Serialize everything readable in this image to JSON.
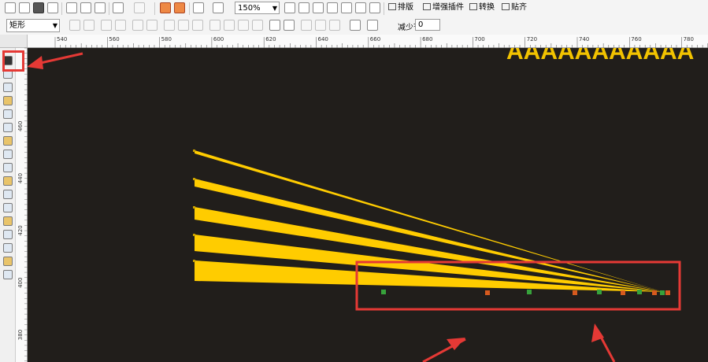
{
  "toolbar": {
    "zoom_value": "150%",
    "menu_items": [
      {
        "label": "排版"
      },
      {
        "label": "增强插件"
      },
      {
        "label": "转换"
      },
      {
        "label": "贴齐"
      }
    ]
  },
  "property_bar": {
    "shape_selector": "矩形",
    "reduce_nodes_label": "减少节点",
    "reduce_nodes_value": "0"
  },
  "rulers": {
    "horizontal_labels": [
      "540",
      "560",
      "580",
      "600",
      "620",
      "640",
      "660",
      "680",
      "700",
      "720",
      "740",
      "760",
      "780"
    ],
    "vertical_labels": [
      "460",
      "440",
      "420",
      "400",
      "380"
    ]
  },
  "canvas": {
    "background": "#211e1b",
    "shape_color": "#ffcc00",
    "text_fill": "#f2c300",
    "text_content": "AAAAAAAAAAA",
    "highlight_color": "#e53935"
  },
  "tools": [
    {
      "icon": "pick-tool-icon"
    },
    {
      "icon": "shape-tool-icon"
    },
    {
      "icon": "crop-tool-icon"
    },
    {
      "icon": "zoom-tool-icon"
    },
    {
      "icon": "freehand-tool-icon"
    },
    {
      "icon": "smart-fill-icon"
    },
    {
      "icon": "rectangle-tool-icon"
    },
    {
      "icon": "ellipse-tool-icon"
    },
    {
      "icon": "polygon-tool-icon"
    },
    {
      "icon": "basic-shapes-icon"
    },
    {
      "icon": "text-tool-icon"
    },
    {
      "icon": "table-tool-icon"
    },
    {
      "icon": "blend-tool-icon"
    },
    {
      "icon": "eyedropper-tool-icon"
    },
    {
      "icon": "outline-pen-icon"
    },
    {
      "icon": "fill-tool-icon"
    },
    {
      "icon": "interactive-fill-icon"
    }
  ]
}
